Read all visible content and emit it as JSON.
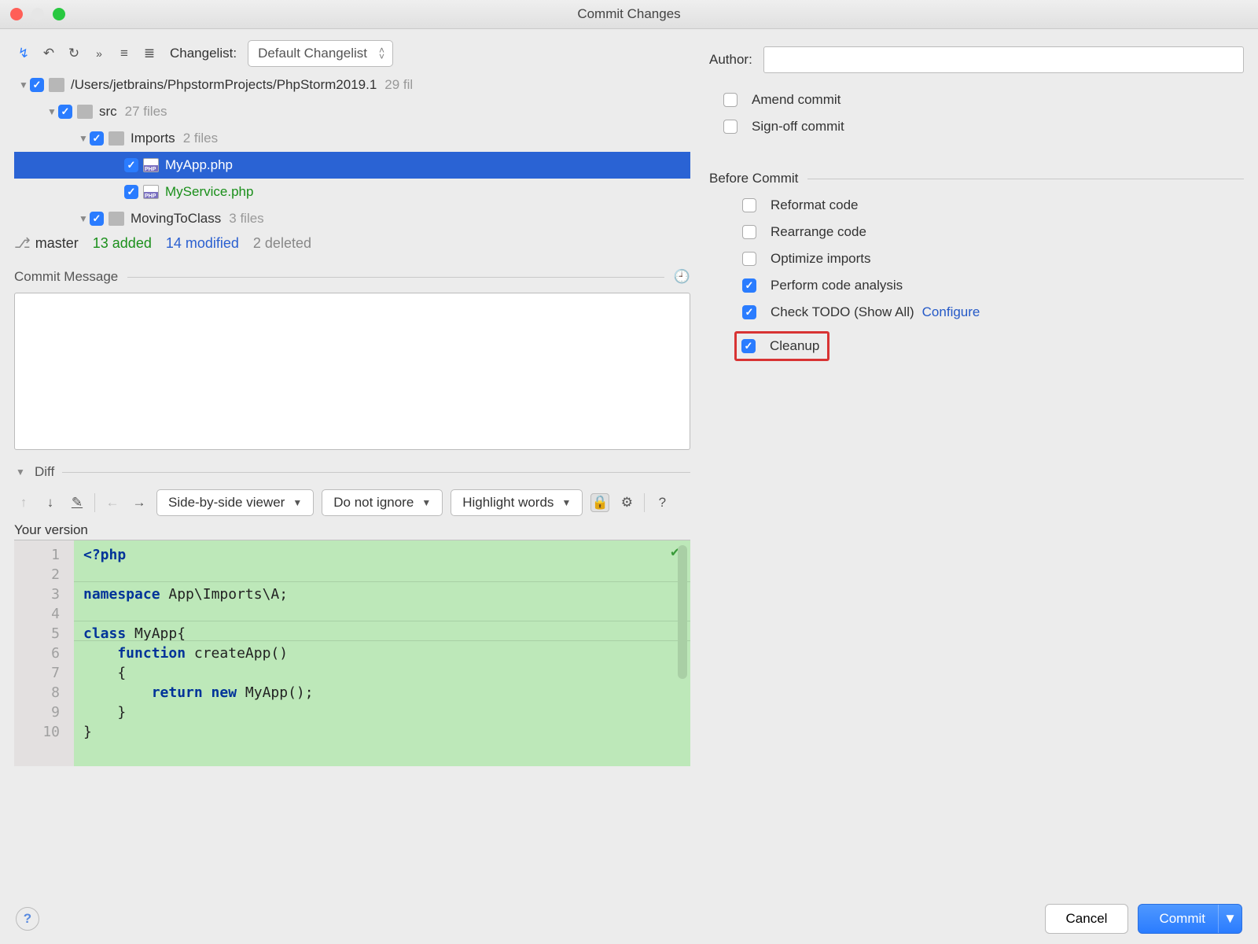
{
  "window": {
    "title": "Commit Changes"
  },
  "toolbar": {
    "changelist_label": "Changelist:",
    "changelist_value": "Default Changelist"
  },
  "tree": {
    "root_path": "/Users/jetbrains/PhpstormProjects/PhpStorm2019.1",
    "root_count": "29 fil",
    "src_label": "src",
    "src_count": "27 files",
    "imports_label": "Imports",
    "imports_count": "2 files",
    "myapp": "MyApp.php",
    "myservice": "MyService.php",
    "moving_label": "MovingToClass",
    "moving_count": "3 files"
  },
  "branch": {
    "name": "master",
    "added": "13 added",
    "modified": "14 modified",
    "deleted": "2 deleted"
  },
  "sections": {
    "commit_message": "Commit Message",
    "diff": "Diff",
    "your_version": "Your version",
    "before_commit": "Before Commit"
  },
  "diff": {
    "viewer": "Side-by-side viewer",
    "ignore": "Do not ignore",
    "highlight": "Highlight words"
  },
  "code": {
    "l1": "<?php",
    "l2": "",
    "l3a": "namespace",
    "l3b": " App\\Imports\\A;",
    "l4": "",
    "l5a": "class",
    "l5b": " MyApp{",
    "l6a": "    function",
    "l6b": " createApp()",
    "l7": "    {",
    "l8a": "        return new",
    "l8b": " MyApp();",
    "l9": "    }",
    "l10": "}"
  },
  "author": {
    "label": "Author:"
  },
  "options": {
    "amend": "Amend commit",
    "signoff": "Sign-off commit",
    "reformat": "Reformat code",
    "rearrange": "Rearrange code",
    "optimize": "Optimize imports",
    "analysis": "Perform code analysis",
    "todo": "Check TODO (Show All)",
    "configure": "Configure",
    "cleanup": "Cleanup"
  },
  "footer": {
    "cancel": "Cancel",
    "commit": "Commit"
  }
}
